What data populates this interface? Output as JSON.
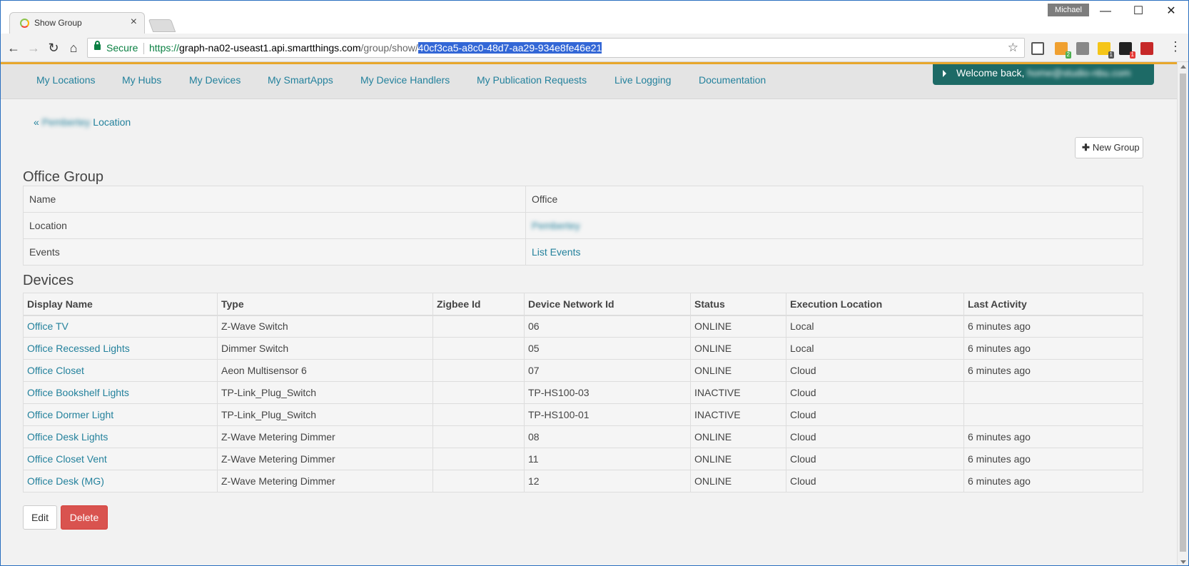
{
  "browser": {
    "tab_title": "Show Group",
    "tab_close": "×",
    "profile_name": "Michael",
    "window_controls": {
      "minimize": "—",
      "maximize": "☐",
      "close": "✕"
    },
    "nav": {
      "back": "←",
      "forward": "→",
      "reload": "↻",
      "home": "⌂"
    },
    "secure_label": "Secure",
    "url_scheme": "https://",
    "url_host": "graph-na02-useast1.api.smartthings.com",
    "url_path": "/group/show/",
    "url_selected": "40cf3ca5-a8c0-48d7-aa29-934e8fe46e21",
    "bookmark_star": "☆",
    "extensions": [
      {
        "icon": "cast-icon",
        "badge": ""
      },
      {
        "icon": "extension-orange-icon",
        "badge": "2",
        "color": "#f0a030",
        "badge_color": "#4caf50"
      },
      {
        "icon": "pocket-icon",
        "badge": "",
        "color": "#888888"
      },
      {
        "icon": "lastpass-icon",
        "badge": "1",
        "color": "#f5c518",
        "badge_color": "#555555"
      },
      {
        "icon": "amazon-icon",
        "badge": "1",
        "color": "#222222",
        "badge_color": "#e53935"
      },
      {
        "icon": "acrobat-icon",
        "badge": "",
        "color": "#c62828"
      }
    ],
    "menu": "⋮"
  },
  "topnav": {
    "items": [
      "My Locations",
      "My Hubs",
      "My Devices",
      "My SmartApps",
      "My Device Handlers",
      "My Publication Requests",
      "Live Logging",
      "Documentation"
    ],
    "welcome_prefix": "Welcome back,",
    "welcome_user": "home@studio-nbu.com"
  },
  "breadcrumb": {
    "prefix": "«",
    "location_name": "Pembertey",
    "suffix": "Location"
  },
  "new_group_label": "New Group",
  "group": {
    "heading": "Office Group",
    "rows": [
      {
        "label": "Name",
        "value": "Office",
        "is_link": false
      },
      {
        "label": "Location",
        "value": "Pembertey",
        "is_link": true,
        "blurred": true
      },
      {
        "label": "Events",
        "value": "List Events",
        "is_link": true
      }
    ]
  },
  "devices": {
    "heading": "Devices",
    "columns": [
      "Display Name",
      "Type",
      "Zigbee Id",
      "Device Network Id",
      "Status",
      "Execution Location",
      "Last Activity"
    ],
    "rows": [
      [
        "Office TV",
        "Z-Wave Switch",
        "",
        "06",
        "ONLINE",
        "Local",
        "6 minutes ago"
      ],
      [
        "Office Recessed Lights",
        "Dimmer Switch",
        "",
        "05",
        "ONLINE",
        "Local",
        "6 minutes ago"
      ],
      [
        "Office Closet",
        "Aeon Multisensor 6",
        "",
        "07",
        "ONLINE",
        "Cloud",
        "6 minutes ago"
      ],
      [
        "Office Bookshelf Lights",
        "TP-Link_Plug_Switch",
        "",
        "TP-HS100-03",
        "INACTIVE",
        "Cloud",
        ""
      ],
      [
        "Office Dormer Light",
        "TP-Link_Plug_Switch",
        "",
        "TP-HS100-01",
        "INACTIVE",
        "Cloud",
        ""
      ],
      [
        "Office Desk Lights",
        "Z-Wave Metering Dimmer",
        "",
        "08",
        "ONLINE",
        "Cloud",
        "6 minutes ago"
      ],
      [
        "Office Closet Vent",
        "Z-Wave Metering Dimmer",
        "",
        "11",
        "ONLINE",
        "Cloud",
        "6 minutes ago"
      ],
      [
        "Office Desk (MG)",
        "Z-Wave Metering Dimmer",
        "",
        "12",
        "ONLINE",
        "Cloud",
        "6 minutes ago"
      ]
    ]
  },
  "actions": {
    "edit": "Edit",
    "delete": "Delete"
  },
  "colors": {
    "link": "#23819c",
    "accent_bar": "#e8a72c",
    "welcome_bg": "#1d6a66",
    "delete_bg": "#d9534f",
    "secure_green": "#0b8043",
    "url_selection": "#3367d6"
  }
}
